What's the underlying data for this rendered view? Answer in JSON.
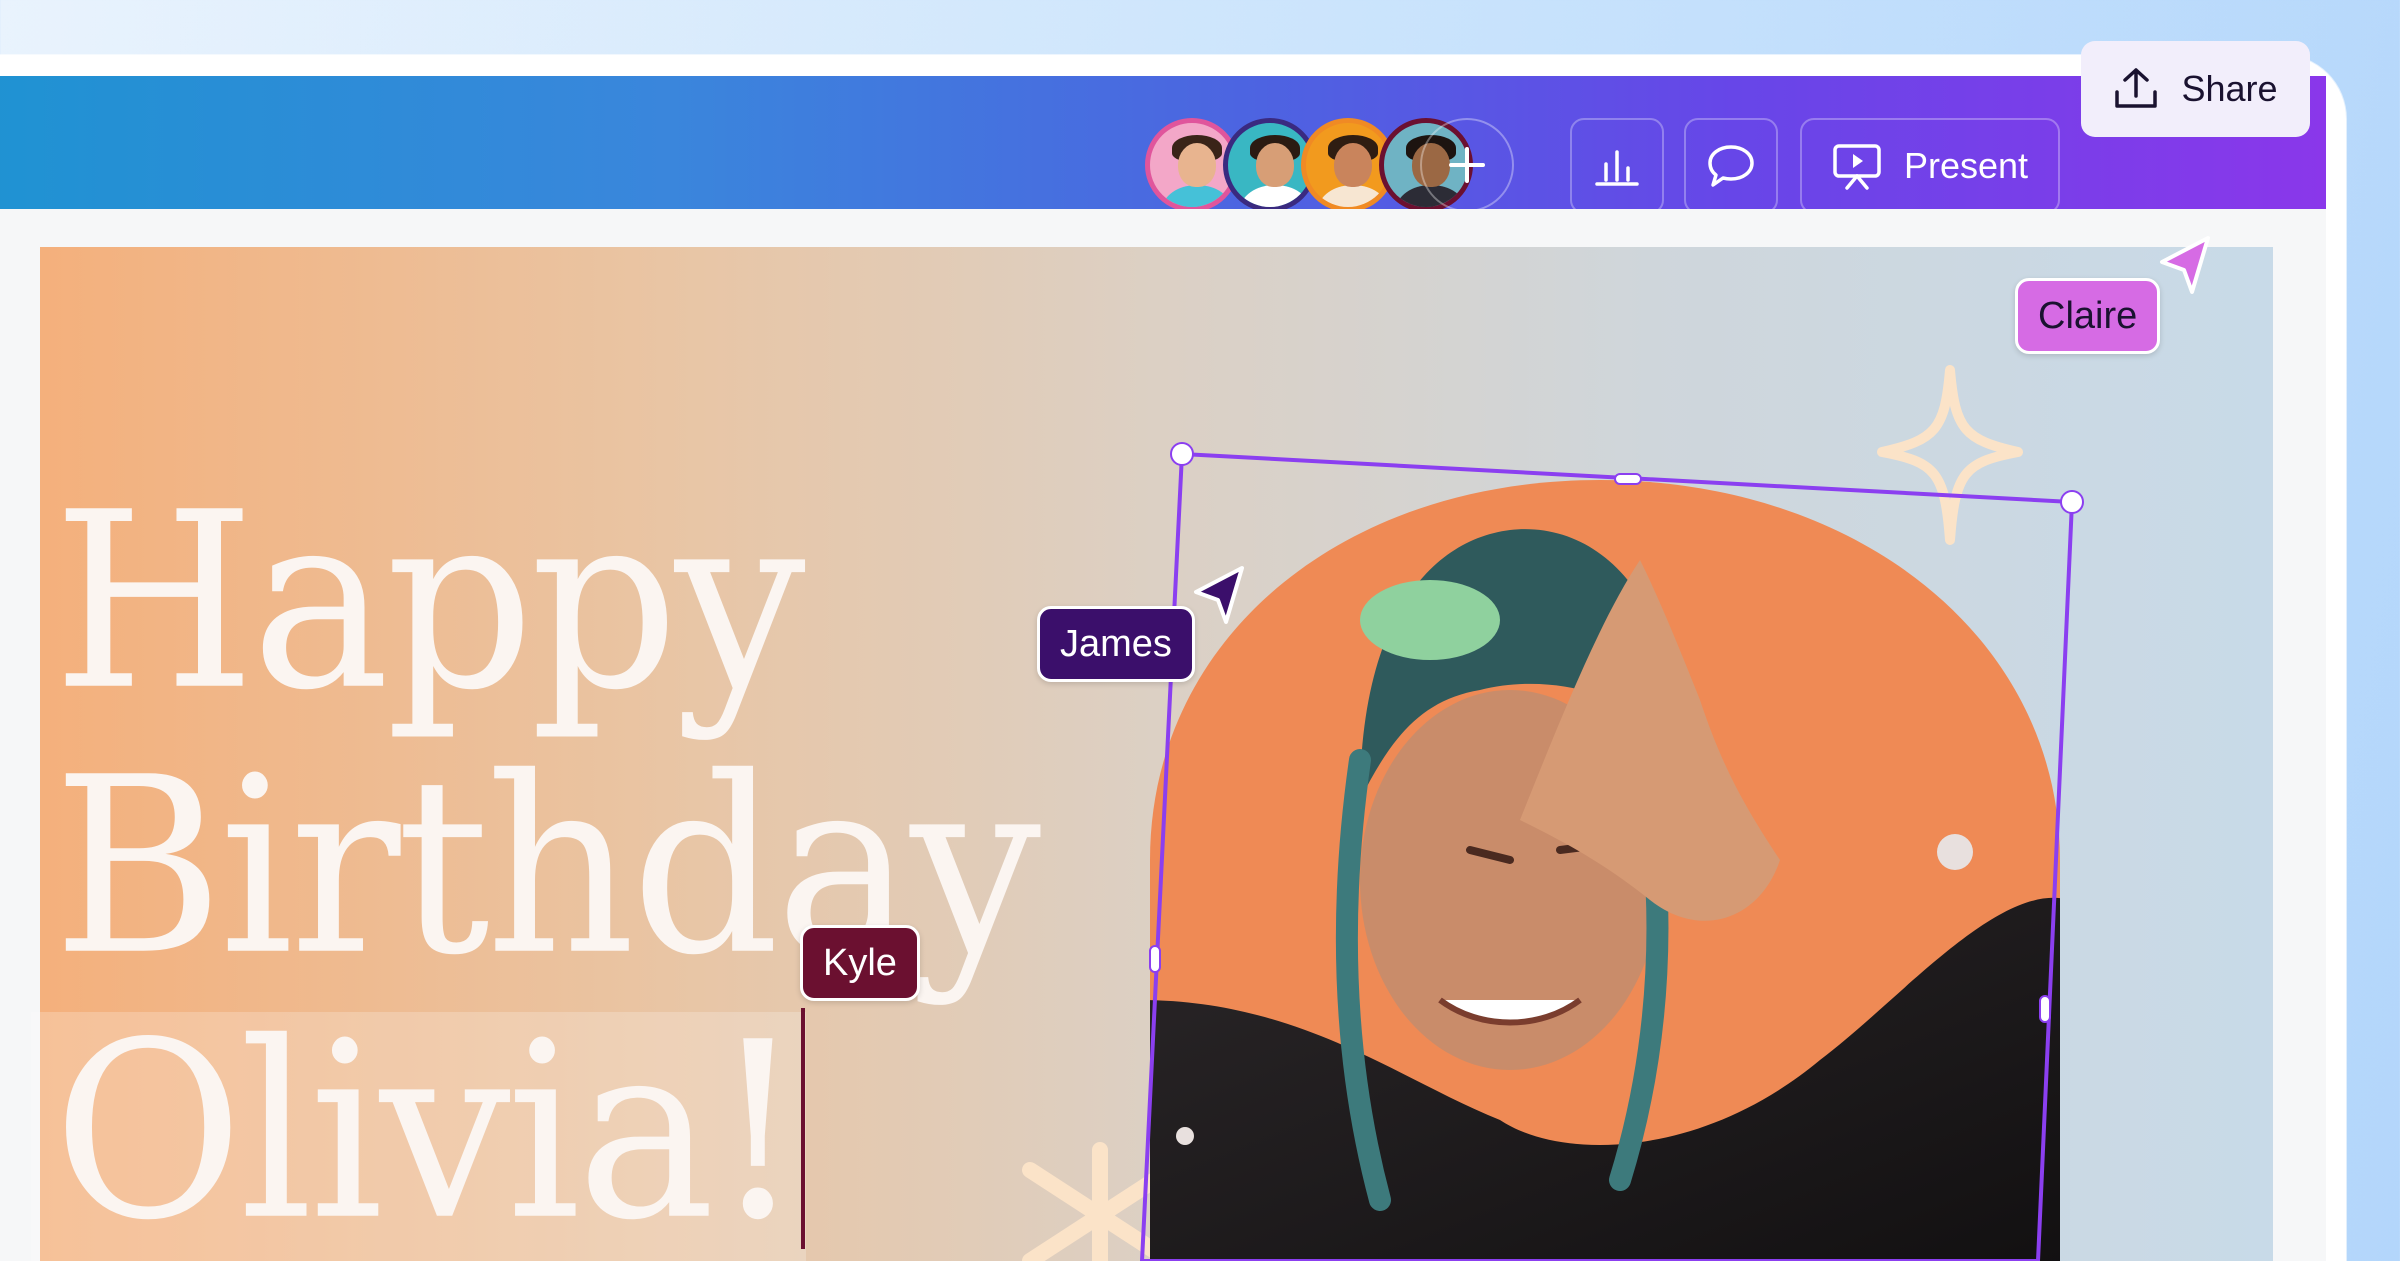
{
  "toolbar": {
    "collaborators": [
      {
        "name": "avatar-1",
        "ring": "#e0559c",
        "bg": "#f3a7c8",
        "skin": "#e8b48f",
        "hair": "#3a2418",
        "shirt": "#45c1d8"
      },
      {
        "name": "avatar-2",
        "ring": "#3a2a80",
        "bg": "#39b7c3",
        "skin": "#d79e76",
        "hair": "#2b1b12",
        "shirt": "#ffffff"
      },
      {
        "name": "avatar-3",
        "ring": "#f08a24",
        "bg": "#f29a1e",
        "skin": "#c9845c",
        "hair": "#2f1d12",
        "shirt": "#f7e6d2"
      },
      {
        "name": "avatar-4",
        "ring": "#6b1030",
        "bg": "#6fb3c4",
        "skin": "#9b6844",
        "hair": "#1d1410",
        "shirt": "#2c2c36"
      }
    ],
    "present_label": "Present",
    "share_label": "Share"
  },
  "design": {
    "line1": "Happy",
    "line2": "Birthday",
    "line3": "Olivia!"
  },
  "cursors": [
    {
      "name": "Claire",
      "color": "#d66be4",
      "text_color": "#1a1230"
    },
    {
      "name": "James",
      "color": "#3b0f6b",
      "text_color": "#ffffff"
    },
    {
      "name": "Kyle",
      "color": "#6b1030",
      "text_color": "#ffffff"
    }
  ],
  "colors": {
    "selection": "#8b3ff0",
    "accent_orange": "#f0884f",
    "sparkle": "#fbe3c8"
  }
}
